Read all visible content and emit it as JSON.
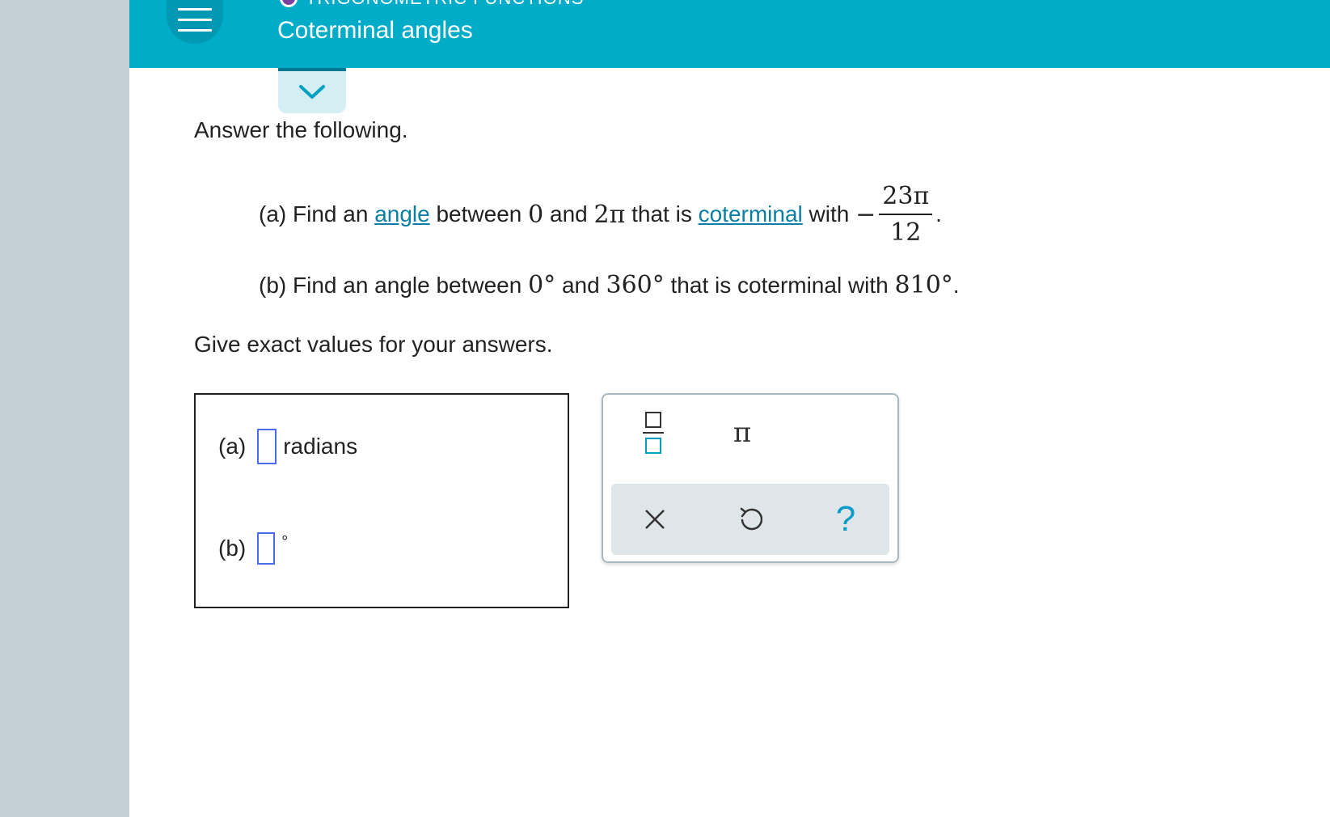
{
  "header": {
    "topic": "TRIGONOMETRIC FUNCTIONS",
    "title": "Coterminal angles"
  },
  "colors": {
    "topbar": "#00acc8",
    "rail": "#c3d0d5",
    "link": "#0a7ea4",
    "slot_border": "#4a6cf0",
    "topic_dot": "#7b3fa0"
  },
  "icons": {
    "menu": "hamburger-menu-icon",
    "collapse": "chevron-down-icon",
    "fraction": "fraction-template-icon",
    "pi": "pi-symbol-icon",
    "clear": "close-icon",
    "undo": "undo-icon",
    "help": "help-icon"
  },
  "problem": {
    "intro": "Answer the following.",
    "a": {
      "label": "(a) Find an",
      "link1": "angle",
      "text2": "between",
      "zero": "0",
      "text3": "and",
      "two_pi": "2π",
      "text4": "that is",
      "link2": "coterminal",
      "text5": "with",
      "minus": "−",
      "frac_num": "23π",
      "frac_den": "12",
      "period": "."
    },
    "b": {
      "label": "(b) Find an angle between",
      "v1": "0°",
      "text2": "and",
      "v2": "360°",
      "text3": "that is coterminal with",
      "v3": "810°",
      "period": "."
    },
    "exact": "Give exact values for your answers."
  },
  "answers": {
    "a_label": "(a)",
    "a_unit": "radians",
    "b_label": "(b)",
    "b_unit": "°"
  },
  "toolbox": {
    "pi": "π",
    "help": "?"
  }
}
